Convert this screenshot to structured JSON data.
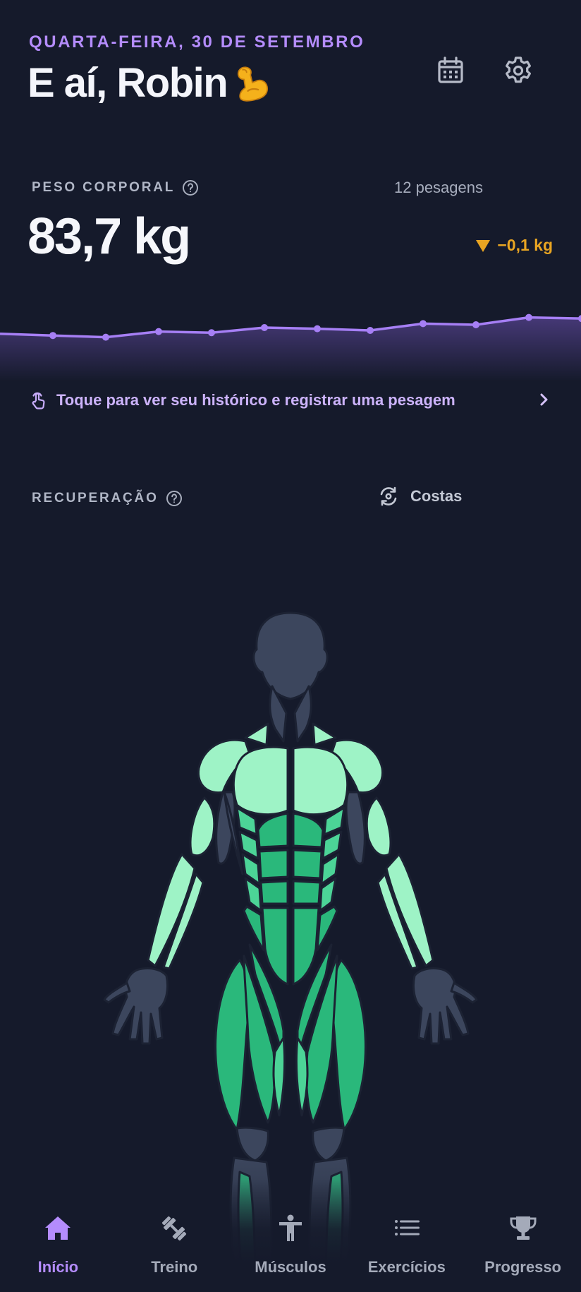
{
  "header": {
    "date": "QUARTA-FEIRA, 30 DE SETEMBRO",
    "greeting": "E aí, Robin",
    "greeting_emoji_icon": "flexed-biceps-icon"
  },
  "body_weight": {
    "label": "PESO CORPORAL",
    "count": "12 pesagens",
    "value": "83,7 kg",
    "delta": "−0,1 kg",
    "trend_points": [
      0.34,
      0.31,
      0.28,
      0.38,
      0.36,
      0.45,
      0.43,
      0.4,
      0.52,
      0.5,
      0.63,
      0.61
    ],
    "hint": "Toque para ver seu histórico e registrar uma pesagem"
  },
  "recovery": {
    "label": "RECUPERAÇÃO",
    "view_toggle": "Costas"
  },
  "nav": [
    {
      "label": "Início",
      "icon": "home-icon",
      "active": true
    },
    {
      "label": "Treino",
      "icon": "dumbbell-icon",
      "active": false
    },
    {
      "label": "Músculos",
      "icon": "person-icon",
      "active": false
    },
    {
      "label": "Exercícios",
      "icon": "list-icon",
      "active": false
    },
    {
      "label": "Progresso",
      "icon": "trophy-icon",
      "active": false
    }
  ],
  "colors": {
    "background": "#151a2b",
    "accent": "#b48cfc",
    "warning": "#e9a522",
    "muscle_light": "#9ef3c6",
    "muscle_mid": "#4cd497",
    "muscle_deep": "#2ab87b",
    "inactive_body": "#3c465d"
  }
}
